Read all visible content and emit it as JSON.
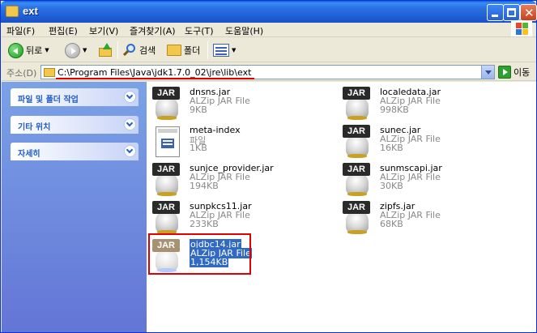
{
  "window": {
    "title": "ext"
  },
  "menu": [
    "파일(F)",
    "편집(E)",
    "보기(V)",
    "즐겨찾기(A)",
    "도구(T)",
    "도움말(H)"
  ],
  "toolbar": {
    "back_label": "뒤로",
    "search_label": "검색",
    "folders_label": "폴더"
  },
  "address": {
    "label": "주소(D)",
    "path": "C:\\Program Files\\Java\\jdk1.7.0_02\\jre\\lib\\ext",
    "go_label": "이동"
  },
  "taskpane": {
    "panels": [
      "파일 및 폴더 작업",
      "기타 위치",
      "자세히"
    ]
  },
  "files": [
    {
      "name": "dnsns.jar",
      "type": "ALZip JAR File",
      "size": "9KB",
      "icon": "jar-icon"
    },
    {
      "name": "localedata.jar",
      "type": "ALZip JAR File",
      "size": "998KB",
      "icon": "jar-icon"
    },
    {
      "name": "meta-index",
      "type": "파일",
      "size": "1KB",
      "icon": "file-icon"
    },
    {
      "name": "sunec.jar",
      "type": "ALZip JAR File",
      "size": "16KB",
      "icon": "jar-icon"
    },
    {
      "name": "sunjce_provider.jar",
      "type": "ALZip JAR File",
      "size": "194KB",
      "icon": "jar-icon"
    },
    {
      "name": "sunmscapi.jar",
      "type": "ALZip JAR File",
      "size": "30KB",
      "icon": "jar-icon"
    },
    {
      "name": "sunpkcs11.jar",
      "type": "ALZip JAR File",
      "size": "233KB",
      "icon": "jar-icon"
    },
    {
      "name": "zipfs.jar",
      "type": "ALZip JAR File",
      "size": "68KB",
      "icon": "jar-icon"
    },
    {
      "name": "ojdbc14.jar",
      "type": "ALZip JAR File",
      "size": "1,154KB",
      "icon": "jar-icon",
      "selected": true
    }
  ],
  "jar_tag": "JAR",
  "colors": {
    "titlebar": "#2D74E6",
    "taskpane": "#7BA2E7",
    "selection": "#316AC5",
    "annotation": "#E00000"
  }
}
